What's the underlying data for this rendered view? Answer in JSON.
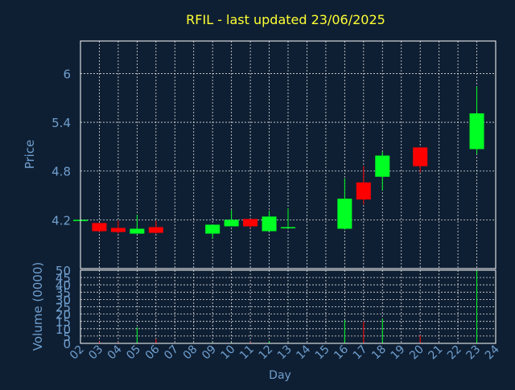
{
  "chart_data": {
    "type": "candlestick",
    "title": "RFIL - last updated 23/06/2025",
    "xlabel": "Day",
    "ylabel": "Price",
    "volume_label": "Volume (0000)",
    "x_ticks": [
      "02",
      "03",
      "04",
      "05",
      "06",
      "07",
      "08",
      "09",
      "10",
      "11",
      "12",
      "13",
      "14",
      "15",
      "16",
      "17",
      "18",
      "19",
      "20",
      "21",
      "22",
      "23",
      "24"
    ],
    "y_ticks": [
      "4.2",
      "4.8",
      "5.4",
      "6"
    ],
    "price_range": [
      3.6,
      6.4
    ],
    "volume_ticks": [
      "0",
      "5",
      "10",
      "15",
      "20",
      "25",
      "30",
      "35",
      "40",
      "45",
      "50"
    ],
    "volume_range": [
      0,
      50
    ],
    "grid": true,
    "colors": {
      "background": "#0f1f33",
      "axes": "#ffffff",
      "grid": "#ffffff",
      "title": "#ffff33",
      "tick_labels": "#6f9fcf",
      "axis_labels": "#6f9fcf",
      "up": "#00ff22",
      "down": "#ff0000"
    },
    "candles": [
      {
        "day": 2,
        "open": 4.19,
        "high": 4.2,
        "low": 4.18,
        "close": 4.2
      },
      {
        "day": 3,
        "open": 4.16,
        "high": 4.16,
        "low": 4.05,
        "close": 4.06
      },
      {
        "day": 4,
        "open": 4.1,
        "high": 4.19,
        "low": 4.03,
        "close": 4.05
      },
      {
        "day": 5,
        "open": 4.03,
        "high": 4.26,
        "low": 4.03,
        "close": 4.09
      },
      {
        "day": 6,
        "open": 4.11,
        "high": 4.19,
        "low": 4.03,
        "close": 4.04
      },
      {
        "day": 9,
        "open": 4.03,
        "high": 4.14,
        "low": 3.97,
        "close": 4.14
      },
      {
        "day": 10,
        "open": 4.12,
        "high": 4.32,
        "low": 4.12,
        "close": 4.2
      },
      {
        "day": 11,
        "open": 4.21,
        "high": 4.21,
        "low": 4.1,
        "close": 4.12
      },
      {
        "day": 12,
        "open": 4.06,
        "high": 4.31,
        "low": 4.06,
        "close": 4.24
      },
      {
        "day": 13,
        "open": 4.1,
        "high": 4.34,
        "low": 4.1,
        "close": 4.11
      },
      {
        "day": 16,
        "open": 4.09,
        "high": 4.71,
        "low": 4.08,
        "close": 4.46
      },
      {
        "day": 17,
        "open": 4.66,
        "high": 4.86,
        "low": 4.39,
        "close": 4.45
      },
      {
        "day": 18,
        "open": 4.73,
        "high": 5.04,
        "low": 4.56,
        "close": 4.99
      },
      {
        "day": 20,
        "open": 5.09,
        "high": 5.09,
        "low": 4.78,
        "close": 4.86
      },
      {
        "day": 23,
        "open": 5.07,
        "high": 5.84,
        "low": 5.01,
        "close": 5.51
      }
    ],
    "volume": [
      {
        "day": 2,
        "value": 0.5
      },
      {
        "day": 3,
        "value": 1.2
      },
      {
        "day": 4,
        "value": 0.8
      },
      {
        "day": 5,
        "value": 11
      },
      {
        "day": 6,
        "value": 3
      },
      {
        "day": 9,
        "value": 0.6
      },
      {
        "day": 10,
        "value": 0.5
      },
      {
        "day": 11,
        "value": 1
      },
      {
        "day": 12,
        "value": 1.5
      },
      {
        "day": 13,
        "value": 0.5
      },
      {
        "day": 16,
        "value": 16
      },
      {
        "day": 17,
        "value": 15
      },
      {
        "day": 18,
        "value": 17
      },
      {
        "day": 20,
        "value": 5.5
      },
      {
        "day": 23,
        "value": 50
      }
    ]
  }
}
